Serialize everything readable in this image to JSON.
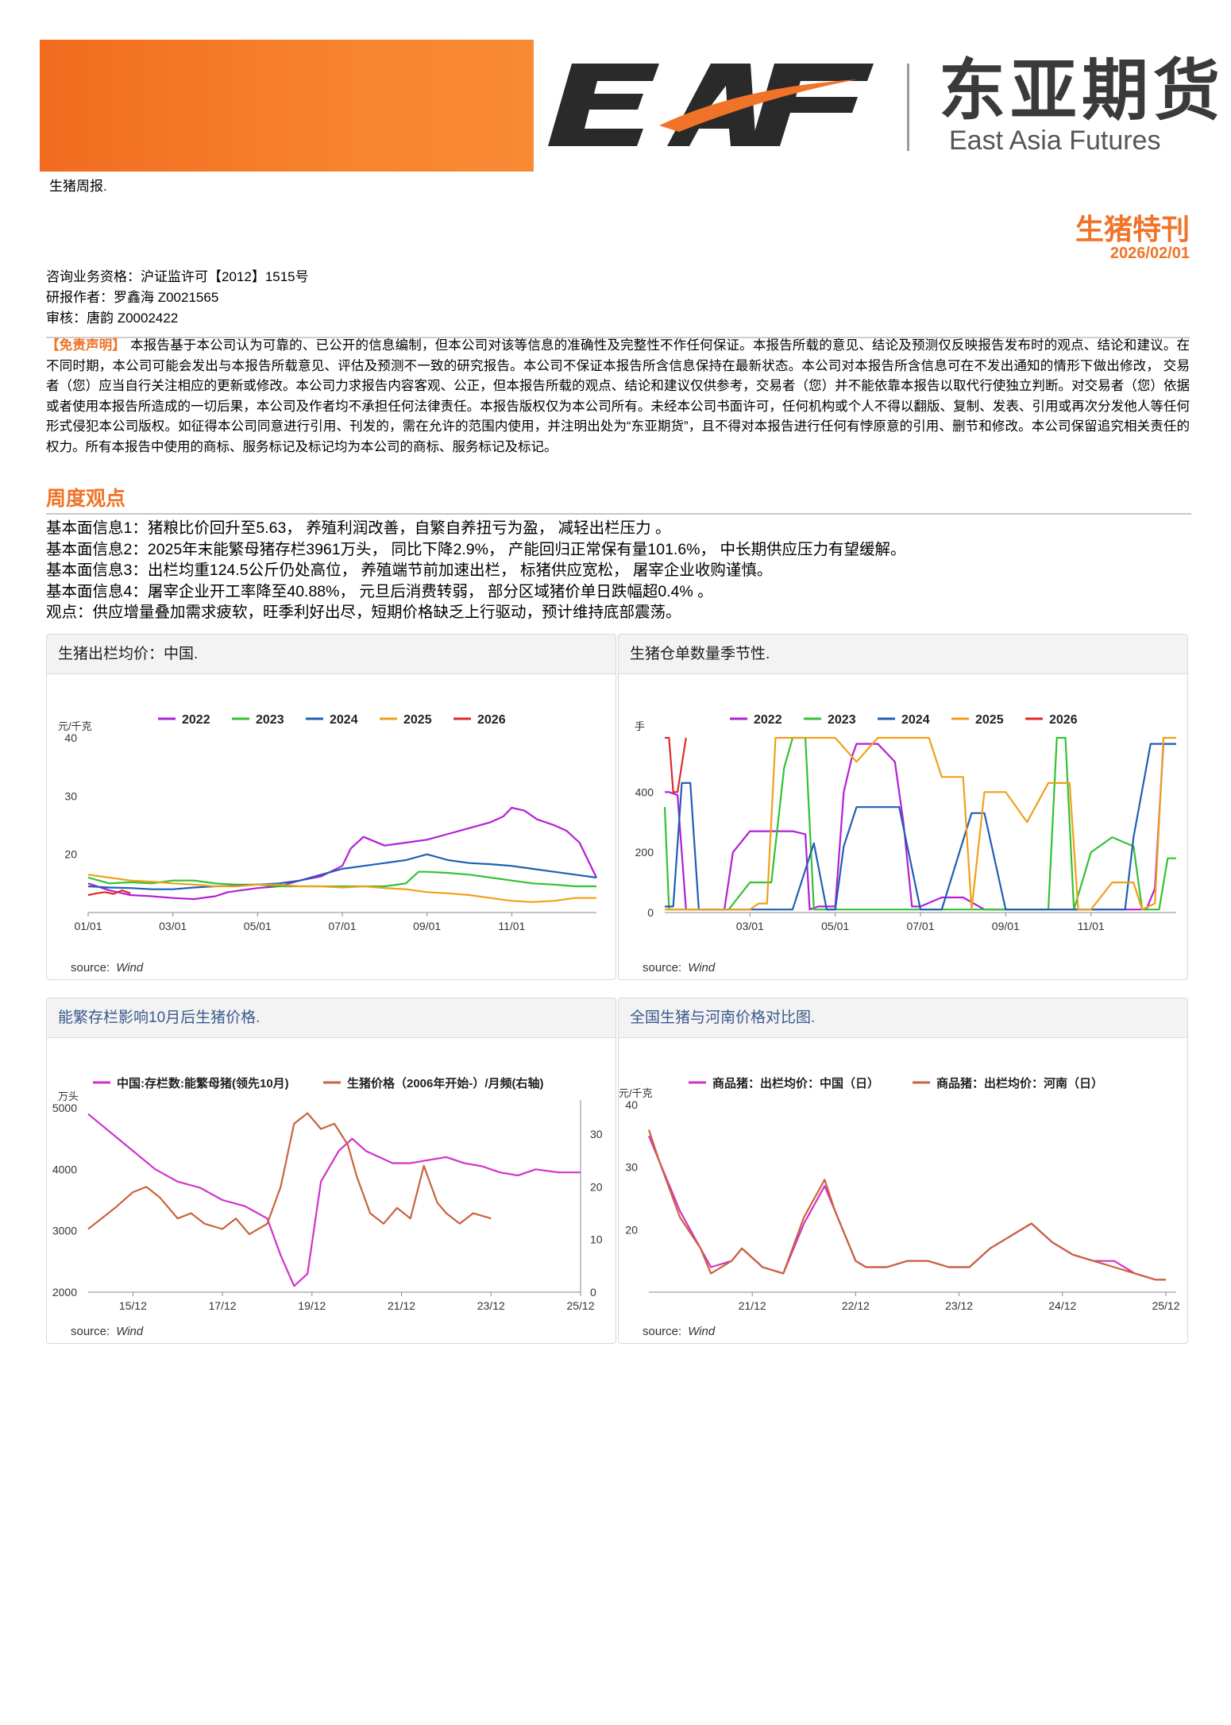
{
  "header": {
    "subtitle": "生猪周报.",
    "logo_letters": "EAF",
    "logo_cn": "东亚期货",
    "logo_en": "East Asia Futures",
    "accent_color": "#f07328"
  },
  "report": {
    "title": "生猪特刊",
    "date": "2026/02/01"
  },
  "meta": {
    "qualification": "咨询业务资格：沪证监许可【2012】1515号",
    "author": "研报作者：罗鑫海 Z0021565",
    "reviewer": "审核：唐韵 Z0002422"
  },
  "disclaimer": {
    "lead": "【免责声明】",
    "text": "本报告基于本公司认为可靠的、已公开的信息编制，但本公司对该等信息的准确性及完整性不作任何保证。本报告所载的意见、结论及预测仅反映报告发布时的观点、结论和建议。在不同时期，本公司可能会发出与本报告所载意见、评估及预测不一致的研究报告。本公司不保证本报告所含信息保持在最新状态。本公司对本报告所含信息可在不发出通知的情形下做出修改， 交易者（您）应当自行关注相应的更新或修改。本公司力求报告内容客观、公正，但本报告所载的观点、结论和建议仅供参考，交易者（您）并不能依靠本报告以取代行使独立判断。对交易者（您）依据或者使用本报告所造成的一切后果，本公司及作者均不承担任何法律责任。本报告版权仅为本公司所有。未经本公司书面许可，任何机构或个人不得以翻版、复制、发表、引用或再次分发他人等任何形式侵犯本公司版权。如征得本公司同意进行引用、刊发的，需在允许的范围内使用，并注明出处为“东亚期货”，且不得对本报告进行任何有悖原意的引用、删节和修改。本公司保留追究相关责任的权力。所有本报告中使用的商标、服务标记及标记均为本公司的商标、服务标记及标记。"
  },
  "weekly_view": {
    "title": "周度观点",
    "points": [
      "基本面信息1：猪粮比价回升至5.63， 养殖利润改善，自繁自养扭亏为盈， 减轻出栏压力 。",
      "基本面信息2：2025年末能繁母猪存栏3961万头， 同比下降2.9%， 产能回归正常保有量101.6%， 中长期供应压力有望缓解。",
      "基本面信息3：出栏均重124.5公斤仍处高位， 养殖端节前加速出栏， 标猪供应宽松， 屠宰企业收购谨慎。",
      "基本面信息4：屠宰企业开工率降至40.88%， 元旦后消费转弱， 部分区域猪价单日跌幅超0.4% 。",
      "观点：供应增量叠加需求疲软，旺季利好出尽，短期价格缺乏上行驱动，预计维持底部震荡。"
    ]
  },
  "source_label": "source:",
  "source_name": "Wind",
  "chart_data": [
    {
      "type": "line",
      "title": "生猪出栏均价：中国.",
      "ylabel": "元/千克",
      "ylim": [
        10,
        40
      ],
      "yticks": [
        20,
        30,
        40
      ],
      "xticks": [
        "01/01",
        "03/01",
        "05/01",
        "07/01",
        "09/01",
        "11/01"
      ],
      "x_range_months": [
        0,
        12
      ],
      "series": [
        {
          "name": "2022",
          "color": "#b31fd6",
          "x": [
            0,
            0.5,
            1,
            1.5,
            2,
            2.5,
            3,
            3.3,
            4,
            4.5,
            5,
            5.5,
            6,
            6.2,
            6.5,
            7,
            7.5,
            8,
            8.5,
            9,
            9.5,
            9.8,
            10,
            10.3,
            10.6,
            11,
            11.3,
            11.6,
            12
          ],
          "y": [
            15.0,
            13.8,
            13.0,
            12.8,
            12.5,
            12.3,
            12.8,
            13.5,
            14.2,
            14.5,
            15.5,
            16.2,
            18.0,
            21.0,
            23.0,
            21.5,
            22.0,
            22.5,
            23.5,
            24.5,
            25.5,
            26.5,
            28.0,
            27.5,
            26.0,
            25.0,
            24.0,
            22.0,
            16.0
          ]
        },
        {
          "name": "2023",
          "color": "#33c233",
          "x": [
            0,
            0.5,
            1,
            1.5,
            2,
            2.5,
            3,
            3.5,
            4,
            4.5,
            5,
            5.5,
            6,
            6.5,
            7,
            7.5,
            7.8,
            8,
            8.5,
            9,
            9.5,
            10,
            10.5,
            11,
            11.5,
            12
          ],
          "y": [
            16.0,
            15.0,
            15.2,
            15.0,
            15.5,
            15.5,
            15.0,
            14.8,
            14.8,
            14.5,
            14.5,
            14.5,
            14.5,
            14.5,
            14.5,
            15.0,
            17.0,
            17.0,
            16.8,
            16.5,
            16.0,
            15.5,
            15.0,
            14.8,
            14.5,
            14.5
          ]
        },
        {
          "name": "2024",
          "color": "#1f5fb5",
          "x": [
            0,
            0.5,
            1,
            1.5,
            2,
            2.5,
            3,
            3.5,
            4,
            4.5,
            5,
            5.5,
            6,
            6.5,
            7,
            7.5,
            8,
            8.5,
            9,
            9.5,
            10,
            10.5,
            11,
            11.5,
            12
          ],
          "y": [
            14.5,
            14.3,
            14.2,
            14.0,
            14.0,
            14.3,
            14.5,
            14.6,
            14.8,
            15.0,
            15.5,
            16.5,
            17.5,
            18.0,
            18.5,
            19.0,
            20.0,
            19.0,
            18.5,
            18.3,
            18.0,
            17.5,
            17.0,
            16.5,
            16.0
          ]
        },
        {
          "name": "2025",
          "color": "#f0a019",
          "x": [
            0,
            0.5,
            1,
            1.5,
            2,
            2.5,
            3,
            3.5,
            4,
            4.5,
            5,
            5.5,
            6,
            6.5,
            7,
            7.5,
            8,
            8.5,
            9,
            9.5,
            10,
            10.5,
            11,
            11.5,
            12
          ],
          "y": [
            16.5,
            16.0,
            15.5,
            15.3,
            15.0,
            14.8,
            14.5,
            14.5,
            14.8,
            14.8,
            14.5,
            14.5,
            14.3,
            14.5,
            14.2,
            14.0,
            13.5,
            13.3,
            13.0,
            12.5,
            12.0,
            11.8,
            12.0,
            12.5,
            12.5
          ]
        },
        {
          "name": "2026",
          "color": "#e02a2a",
          "x": [
            0,
            0.2,
            0.4,
            0.6,
            0.8,
            1.0
          ],
          "y": [
            13.0,
            13.3,
            13.5,
            13.2,
            13.8,
            13.3
          ]
        }
      ],
      "legend": "top-center",
      "grid": false
    },
    {
      "type": "line",
      "title": "生猪仓单数量季节性.",
      "ylabel": "手",
      "ylim": [
        0,
        580
      ],
      "yticks": [
        0,
        200,
        400
      ],
      "xticks": [
        "03/01",
        "05/01",
        "07/01",
        "09/01",
        "11/01"
      ],
      "x_range_months": [
        0,
        12
      ],
      "series": [
        {
          "name": "2022",
          "color": "#b31fd6",
          "x": [
            0,
            0.1,
            0.3,
            0.5,
            0.7,
            1.0,
            1.2,
            1.4,
            1.6,
            2.0,
            2.5,
            3.0,
            3.3,
            3.4,
            3.6,
            4.0,
            4.2,
            4.4,
            4.5,
            4.8,
            5.0,
            5.2,
            5.4,
            5.6,
            5.8,
            6.0,
            6.5,
            7.0,
            7.5,
            8.0,
            8.5,
            9.0,
            9.5,
            10.0,
            10.5,
            11.0,
            11.3,
            11.5,
            11.7,
            11.8,
            12
          ],
          "y": [
            400,
            400,
            390,
            10,
            10,
            10,
            10,
            10,
            200,
            270,
            270,
            270,
            260,
            10,
            20,
            20,
            400,
            520,
            560,
            560,
            560,
            530,
            500,
            300,
            20,
            20,
            50,
            50,
            10,
            10,
            10,
            10,
            10,
            10,
            10,
            10,
            10,
            80,
            560,
            560,
            560
          ]
        },
        {
          "name": "2023",
          "color": "#33c233",
          "x": [
            0,
            0.1,
            0.2,
            0.5,
            0.7,
            0.9,
            1.1,
            1.5,
            2.0,
            2.5,
            2.8,
            3.0,
            3.3,
            3.5,
            4.0,
            4.5,
            5.0,
            5.5,
            6.0,
            6.5,
            7.0,
            7.5,
            7.8,
            8.0,
            8.5,
            8.7,
            9.0,
            9.2,
            9.4,
            9.6,
            10.0,
            10.5,
            11.0,
            11.2,
            11.4,
            11.6,
            11.8,
            12
          ],
          "y": [
            350,
            10,
            10,
            10,
            10,
            10,
            10,
            10,
            100,
            100,
            480,
            580,
            580,
            10,
            10,
            10,
            10,
            10,
            10,
            10,
            10,
            10,
            10,
            10,
            10,
            10,
            10,
            580,
            580,
            10,
            200,
            250,
            220,
            10,
            10,
            10,
            180,
            180
          ]
        },
        {
          "name": "2024",
          "color": "#1f5fb5",
          "x": [
            0,
            0.2,
            0.4,
            0.6,
            0.8,
            1.0,
            1.2,
            1.5,
            2.0,
            2.5,
            3.0,
            3.5,
            3.8,
            4.0,
            4.2,
            4.5,
            5.0,
            5.5,
            6.0,
            6.2,
            6.5,
            7.0,
            7.2,
            7.5,
            8.0,
            8.2,
            8.5,
            8.7,
            9.0,
            9.2,
            9.4,
            9.6,
            9.8,
            10.0,
            10.3,
            10.6,
            10.8,
            11.0,
            11.4,
            11.6,
            11.8,
            12
          ],
          "y": [
            20,
            20,
            430,
            430,
            10,
            10,
            10,
            10,
            10,
            10,
            10,
            230,
            10,
            10,
            220,
            350,
            350,
            350,
            10,
            10,
            10,
            240,
            330,
            330,
            10,
            10,
            10,
            10,
            10,
            10,
            10,
            10,
            10,
            10,
            10,
            10,
            10,
            250,
            560,
            560,
            560,
            560
          ]
        },
        {
          "name": "2025",
          "color": "#f0a019",
          "x": [
            0,
            0.5,
            1.0,
            1.5,
            2.0,
            2.2,
            2.4,
            2.6,
            3.0,
            3.5,
            4.0,
            4.5,
            5.0,
            5.5,
            5.8,
            6.0,
            6.2,
            6.5,
            7.0,
            7.2,
            7.5,
            8.0,
            8.5,
            9.0,
            9.5,
            9.7,
            10.0,
            10.5,
            11.0,
            11.2,
            11.5,
            11.7,
            12
          ],
          "y": [
            10,
            10,
            10,
            10,
            10,
            30,
            30,
            580,
            580,
            580,
            580,
            500,
            580,
            580,
            580,
            580,
            580,
            450,
            450,
            10,
            400,
            400,
            300,
            430,
            430,
            10,
            10,
            100,
            100,
            10,
            30,
            580,
            580
          ]
        },
        {
          "name": "2026",
          "color": "#e02a2a",
          "x": [
            0,
            0.1,
            0.2,
            0.3,
            0.5
          ],
          "y": [
            580,
            580,
            400,
            400,
            580
          ]
        }
      ],
      "legend": "top-center",
      "grid": false
    },
    {
      "type": "line",
      "title": "能繁存栏影响10月后生猪价格.",
      "ylabel_left": "万头",
      "ylim_left": [
        2000,
        5000
      ],
      "yticks_left": [
        2000,
        3000,
        4000,
        5000
      ],
      "ylim_right": [
        0,
        35
      ],
      "yticks_right": [
        0,
        10,
        20,
        30
      ],
      "xticks": [
        "15/12",
        "17/12",
        "19/12",
        "21/12",
        "23/12",
        "25/12"
      ],
      "x_range_years": [
        2015,
        2026
      ],
      "series": [
        {
          "name": "中国:存栏数:能繁母猪(领先10月)",
          "color": "#d232c8",
          "axis": "left",
          "x": [
            2015.0,
            2015.5,
            2016.0,
            2016.5,
            2017.0,
            2017.5,
            2018.0,
            2018.5,
            2019.0,
            2019.3,
            2019.6,
            2019.9,
            2020.2,
            2020.6,
            2020.9,
            2021.2,
            2021.5,
            2021.8,
            2022.2,
            2022.6,
            2023.0,
            2023.4,
            2023.8,
            2024.2,
            2024.6,
            2025.0,
            2025.5,
            2026.0
          ],
          "y": [
            4900,
            4600,
            4300,
            4000,
            3800,
            3700,
            3500,
            3400,
            3200,
            2600,
            2100,
            2300,
            3800,
            4300,
            4500,
            4300,
            4200,
            4100,
            4100,
            4150,
            4200,
            4100,
            4050,
            3950,
            3900,
            4000,
            3950,
            3950
          ]
        },
        {
          "name": "生猪价格（2006年开始-）/月频(右轴)",
          "color": "#c8643c",
          "axis": "right",
          "x": [
            2015.0,
            2015.3,
            2015.6,
            2016.0,
            2016.3,
            2016.6,
            2017.0,
            2017.3,
            2017.6,
            2018.0,
            2018.3,
            2018.6,
            2019.0,
            2019.3,
            2019.6,
            2019.9,
            2020.2,
            2020.5,
            2020.8,
            2021.0,
            2021.3,
            2021.6,
            2021.9,
            2022.2,
            2022.5,
            2022.8,
            2023.0,
            2023.3,
            2023.6,
            2024.0
          ],
          "y": [
            12,
            14,
            16,
            19,
            20,
            18,
            14,
            15,
            13,
            12,
            14,
            11,
            13,
            20,
            32,
            34,
            31,
            32,
            28,
            22,
            15,
            13,
            16,
            14,
            24,
            17,
            15,
            13,
            15,
            14
          ]
        }
      ],
      "legend": "top-center"
    },
    {
      "type": "line",
      "title": "全国生猪与河南价格对比图.",
      "ylabel": "元/千克",
      "ylim": [
        10,
        40
      ],
      "yticks": [
        20,
        30,
        40
      ],
      "xticks": [
        "21/12",
        "22/12",
        "23/12",
        "24/12",
        "25/12"
      ],
      "x_range_years": [
        2021.0,
        2026.1
      ],
      "series": [
        {
          "name": "商品猪：出栏均价：中国（日）",
          "color": "#d232c8",
          "x": [
            2021.0,
            2021.1,
            2021.3,
            2021.5,
            2021.6,
            2021.8,
            2021.9,
            2022.1,
            2022.3,
            2022.5,
            2022.7,
            2022.8,
            2023.0,
            2023.1,
            2023.3,
            2023.5,
            2023.7,
            2023.9,
            2024.1,
            2024.3,
            2024.5,
            2024.7,
            2024.9,
            2025.1,
            2025.3,
            2025.5,
            2025.7,
            2025.9,
            2026.0
          ],
          "y": [
            35,
            31,
            23,
            17,
            14,
            15,
            17,
            14,
            13,
            21,
            27,
            23,
            15,
            14,
            14,
            15,
            15,
            14,
            14,
            17,
            19,
            21,
            18,
            16,
            15,
            15,
            13,
            12,
            12
          ]
        },
        {
          "name": "商品猪：出栏均价：河南（日）",
          "color": "#c8643c",
          "x": [
            2021.0,
            2021.1,
            2021.3,
            2021.5,
            2021.6,
            2021.8,
            2021.9,
            2022.1,
            2022.3,
            2022.5,
            2022.7,
            2022.8,
            2023.0,
            2023.1,
            2023.3,
            2023.5,
            2023.7,
            2023.9,
            2024.1,
            2024.3,
            2024.5,
            2024.7,
            2024.9,
            2025.1,
            2025.3,
            2025.5,
            2025.7,
            2025.9,
            2026.0
          ],
          "y": [
            36,
            31,
            22,
            17,
            13,
            15,
            17,
            14,
            13,
            22,
            28,
            23,
            15,
            14,
            14,
            15,
            15,
            14,
            14,
            17,
            19,
            21,
            18,
            16,
            15,
            14,
            13,
            12,
            12
          ]
        }
      ],
      "legend": "top-center"
    }
  ]
}
